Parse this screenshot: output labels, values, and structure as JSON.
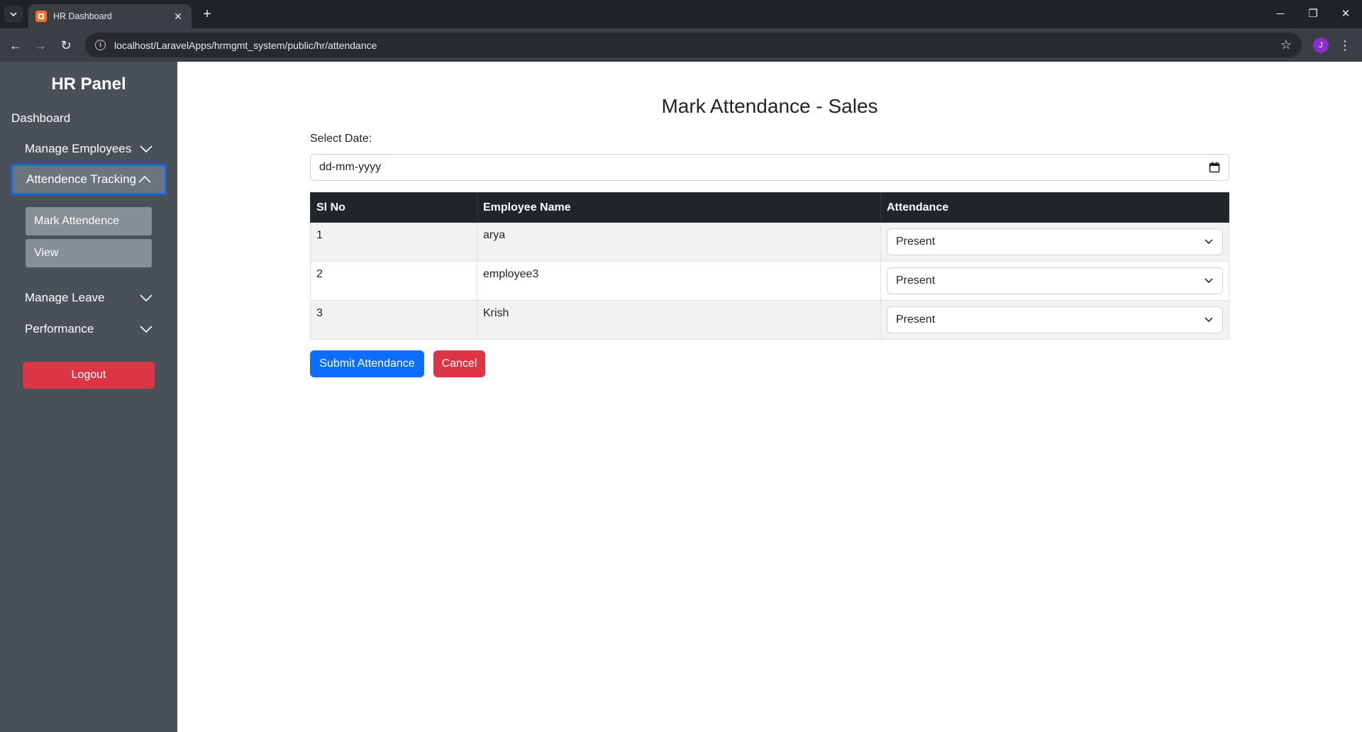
{
  "browser": {
    "tab_title": "HR Dashboard",
    "url": "localhost/LaravelApps/hrmgmt_system/public/hr/attendance",
    "profile_initial": "J"
  },
  "sidebar": {
    "title": "HR Panel",
    "dashboard_label": "Dashboard",
    "items": [
      {
        "label": "Manage Employees",
        "expanded": false
      },
      {
        "label": "Attendence Tracking",
        "expanded": true
      },
      {
        "label": "Manage Leave",
        "expanded": false
      },
      {
        "label": "Performance",
        "expanded": false
      }
    ],
    "attendance_subitems": [
      "Mark Attendence",
      "View"
    ],
    "logout_label": "Logout"
  },
  "main": {
    "title": "Mark Attendance - Sales",
    "date_label": "Select Date:",
    "date_placeholder": "dd-mm-yyyy",
    "table": {
      "headers": [
        "Sl No",
        "Employee Name",
        "Attendance"
      ],
      "rows": [
        {
          "sl": "1",
          "name": "arya",
          "attendance": "Present"
        },
        {
          "sl": "2",
          "name": "employee3",
          "attendance": "Present"
        },
        {
          "sl": "3",
          "name": "Krish",
          "attendance": "Present"
        }
      ]
    },
    "submit_label": "Submit Attendance",
    "cancel_label": "Cancel"
  },
  "colors": {
    "sidebar_bg": "#495057",
    "primary": "#0d6efd",
    "danger": "#dc3545",
    "table_header": "#212529"
  }
}
